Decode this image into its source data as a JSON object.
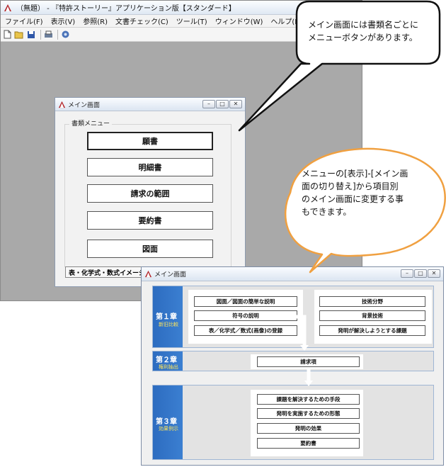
{
  "app": {
    "title": "（無題） - 『特許ストーリー』アプリケーション版【スタンダード】",
    "menu": [
      "ファイル(F)",
      "表示(V)",
      "参照(R)",
      "文書チェック(C)",
      "ツール(T)",
      "ウィンドウ(W)",
      "ヘルプ(H)"
    ],
    "toolbar_icons": [
      "new-file-icon",
      "open-folder-icon",
      "save-icon",
      "print-icon",
      "settings-icon"
    ]
  },
  "window1": {
    "title": "メイン画面",
    "group_label": "書類メニュー",
    "buttons": [
      "願書",
      "明細書",
      "請求の範囲",
      "要約書",
      "図面"
    ],
    "tab": "表・化学式・数式イメージの"
  },
  "window2": {
    "title": "メイン画面",
    "chapters": [
      {
        "no": "第１章",
        "sub": "新旧比較",
        "left": [
          "図面／図面の簡単な説明",
          "符号の説明",
          "表／化学式／数式(画像)の登録"
        ],
        "right": [
          "技術分野",
          "背景技術",
          "発明が解決しようとする課題"
        ]
      },
      {
        "no": "第２章",
        "sub": "権利抽出",
        "items": [
          "請求項"
        ]
      },
      {
        "no": "第３章",
        "sub": "効果例示",
        "items": [
          "課題を解決するための手段",
          "発明を実施するための形態",
          "発明の効果",
          "要約書"
        ]
      }
    ]
  },
  "callouts": {
    "top": [
      "メイン画面には書類名ごとに",
      "メニューボタンがあります。"
    ],
    "bottom": [
      "メニューの[表示]-[メイン画",
      "面の切り替え]から項目別",
      "のメイン画面に変更する事",
      "もできます。"
    ]
  },
  "colors": {
    "chapter_blue": "#2d6cc0",
    "chapter_sub": "#ffe55a",
    "bubble_orange": "#f0a040"
  }
}
